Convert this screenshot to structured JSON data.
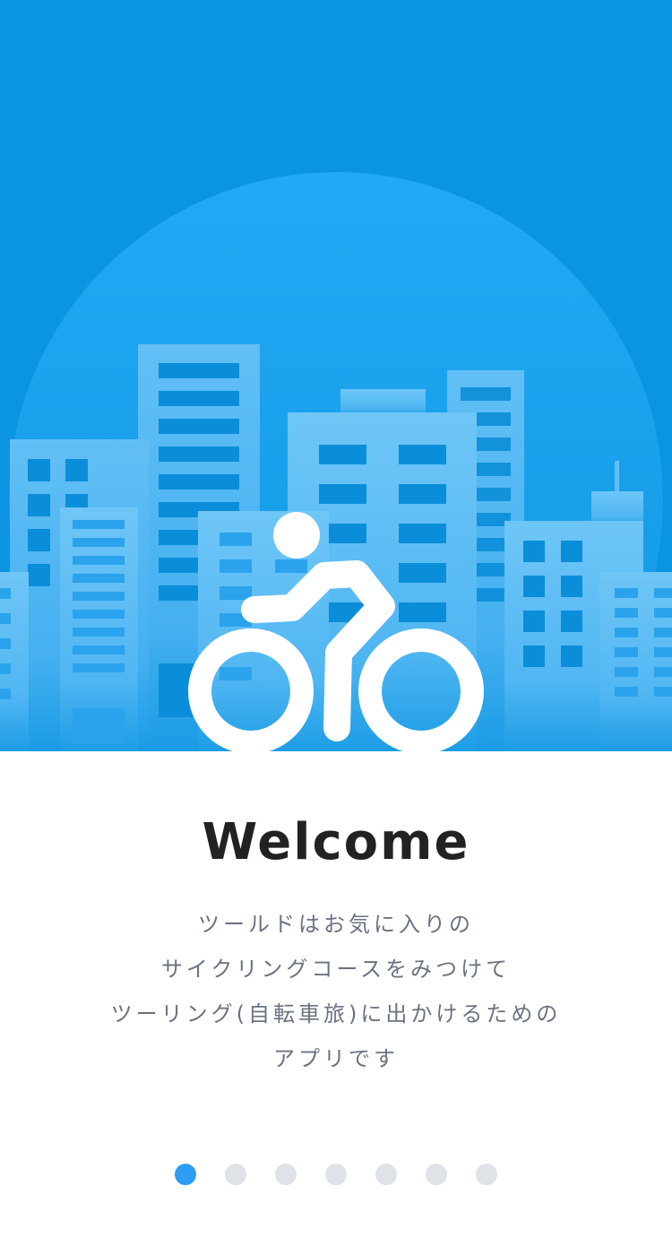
{
  "onboarding": {
    "title": "Welcome",
    "description_lines": [
      "ツールドはお気に入りの",
      "サイクリングコースをみつけて",
      "ツーリング(自転車旅)に出かけるための",
      "アプリです"
    ],
    "pager": {
      "page_count": 7,
      "current_page": 1
    }
  },
  "illustration": {
    "subject": "cyclist-over-city-skyline",
    "icon": "bicycle-rider-icon"
  },
  "colors": {
    "hero_background": "#0b95e0",
    "accent": "#2d9cf3",
    "dot_inactive": "#dfe2e6",
    "title_text": "#222222",
    "body_text": "#6b7280"
  }
}
